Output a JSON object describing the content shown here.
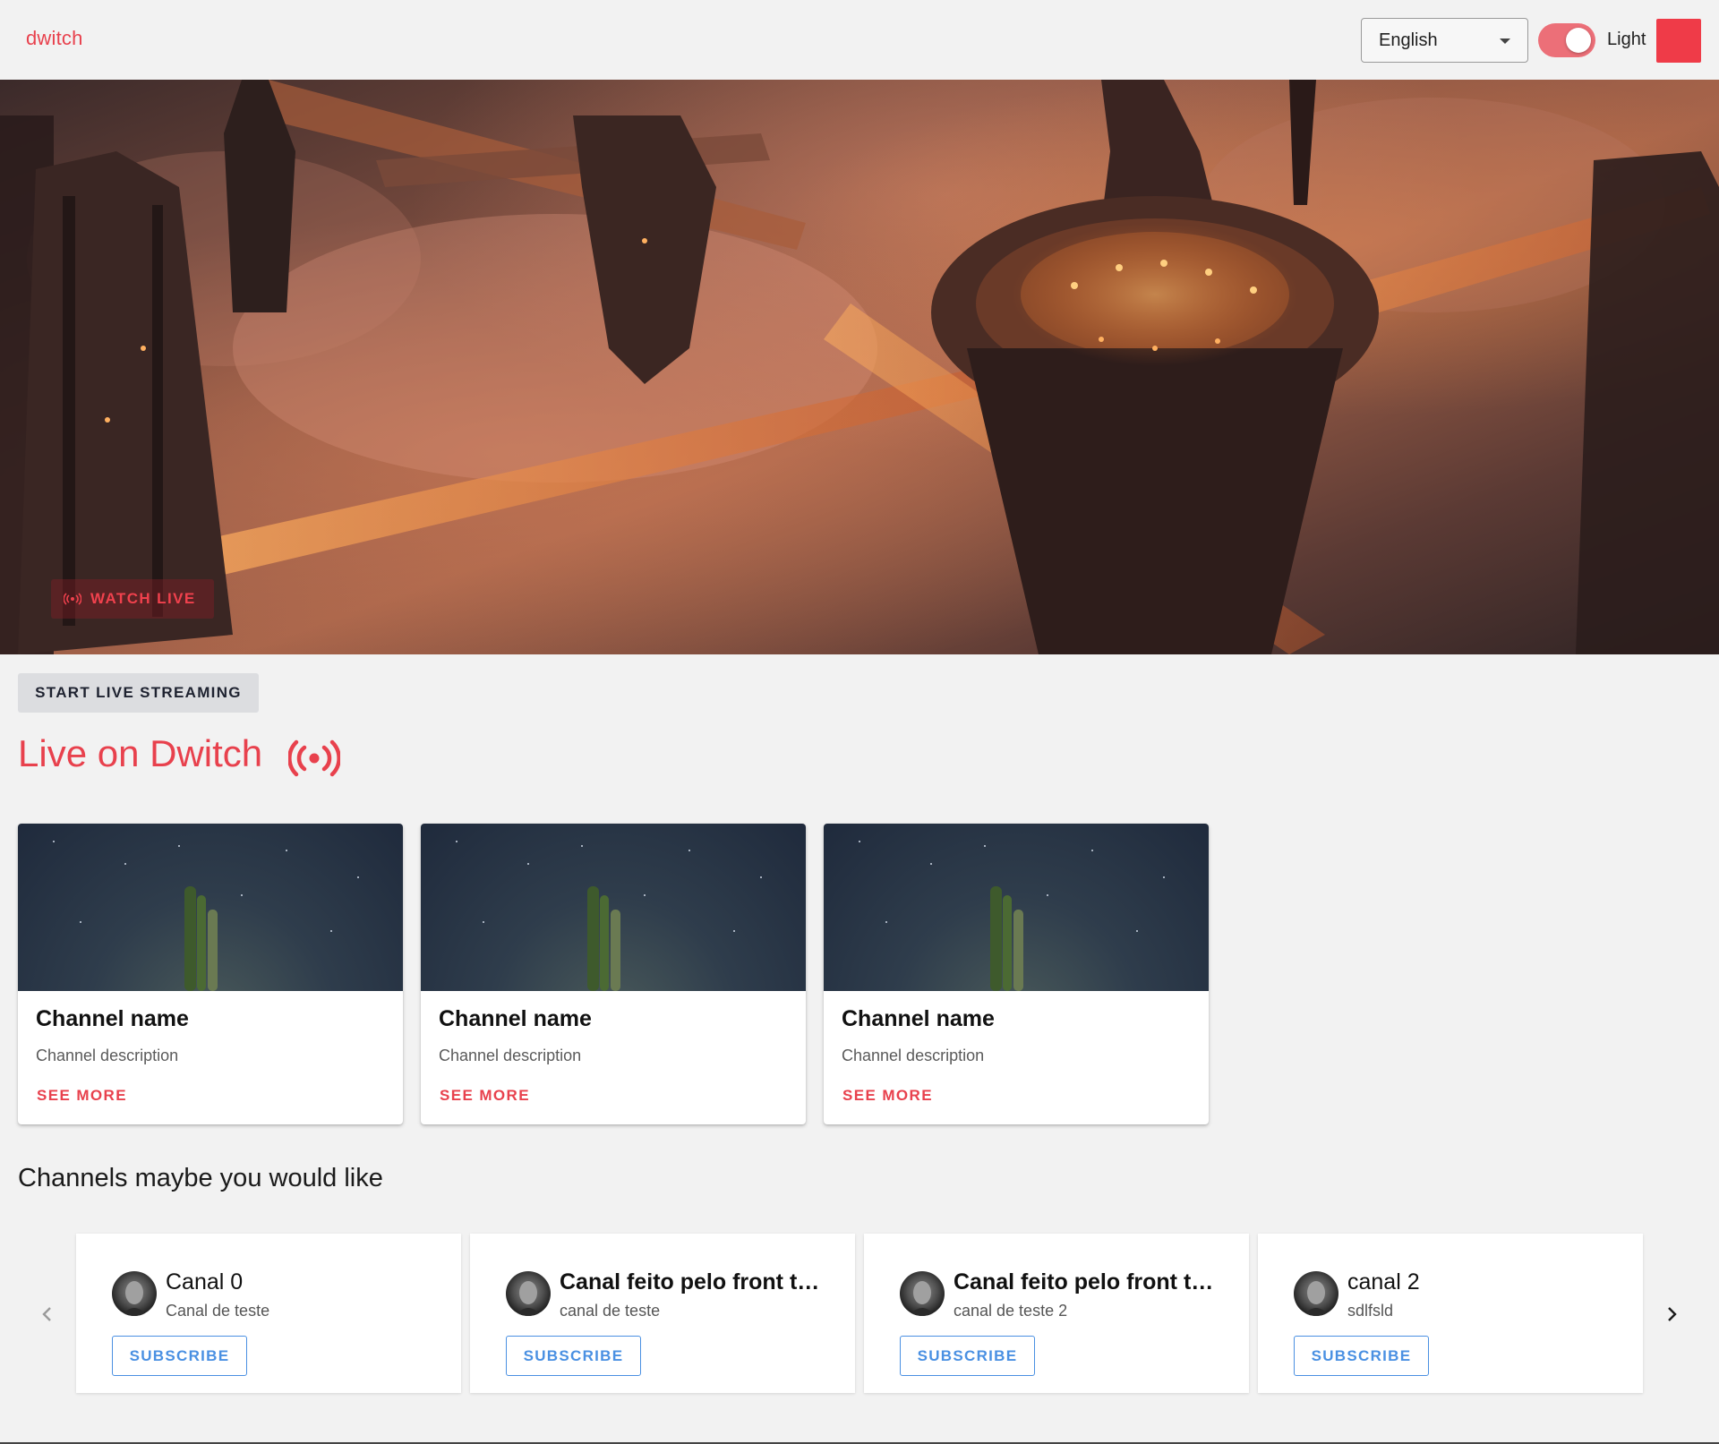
{
  "header": {
    "brand": "dwitch",
    "language": "English",
    "theme_label": "Light",
    "theme_on": true,
    "accent_color": "#e8414d"
  },
  "hero": {
    "watch_live_label": "WATCH LIVE",
    "image": "futuristic-city-banner"
  },
  "main": {
    "start_streaming_label": "START LIVE STREAMING",
    "live_title": "Live on Dwitch",
    "live_cards": [
      {
        "name": "Channel name",
        "description": "Channel description",
        "action": "SEE MORE",
        "image": "cactus-night-sky"
      },
      {
        "name": "Channel name",
        "description": "Channel description",
        "action": "SEE MORE",
        "image": "cactus-night-sky"
      },
      {
        "name": "Channel name",
        "description": "Channel description",
        "action": "SEE MORE",
        "image": "cactus-night-sky"
      }
    ],
    "recommended_title": "Channels maybe you would like",
    "recommended": [
      {
        "name": "Canal 0",
        "description": "Canal de teste",
        "action": "SUBSCRIBE"
      },
      {
        "name": "Canal feito pelo front teste",
        "description": "canal de teste",
        "action": "SUBSCRIBE"
      },
      {
        "name": "Canal feito pelo front teste",
        "description": "canal de teste 2",
        "action": "SUBSCRIBE"
      },
      {
        "name": "canal 2",
        "description": "sdlfsld",
        "action": "SUBSCRIBE"
      }
    ],
    "carousel": {
      "prev_icon": "chevron-left-icon",
      "next_icon": "chevron-right-icon"
    },
    "subscribe_color": "#4a90e2"
  }
}
